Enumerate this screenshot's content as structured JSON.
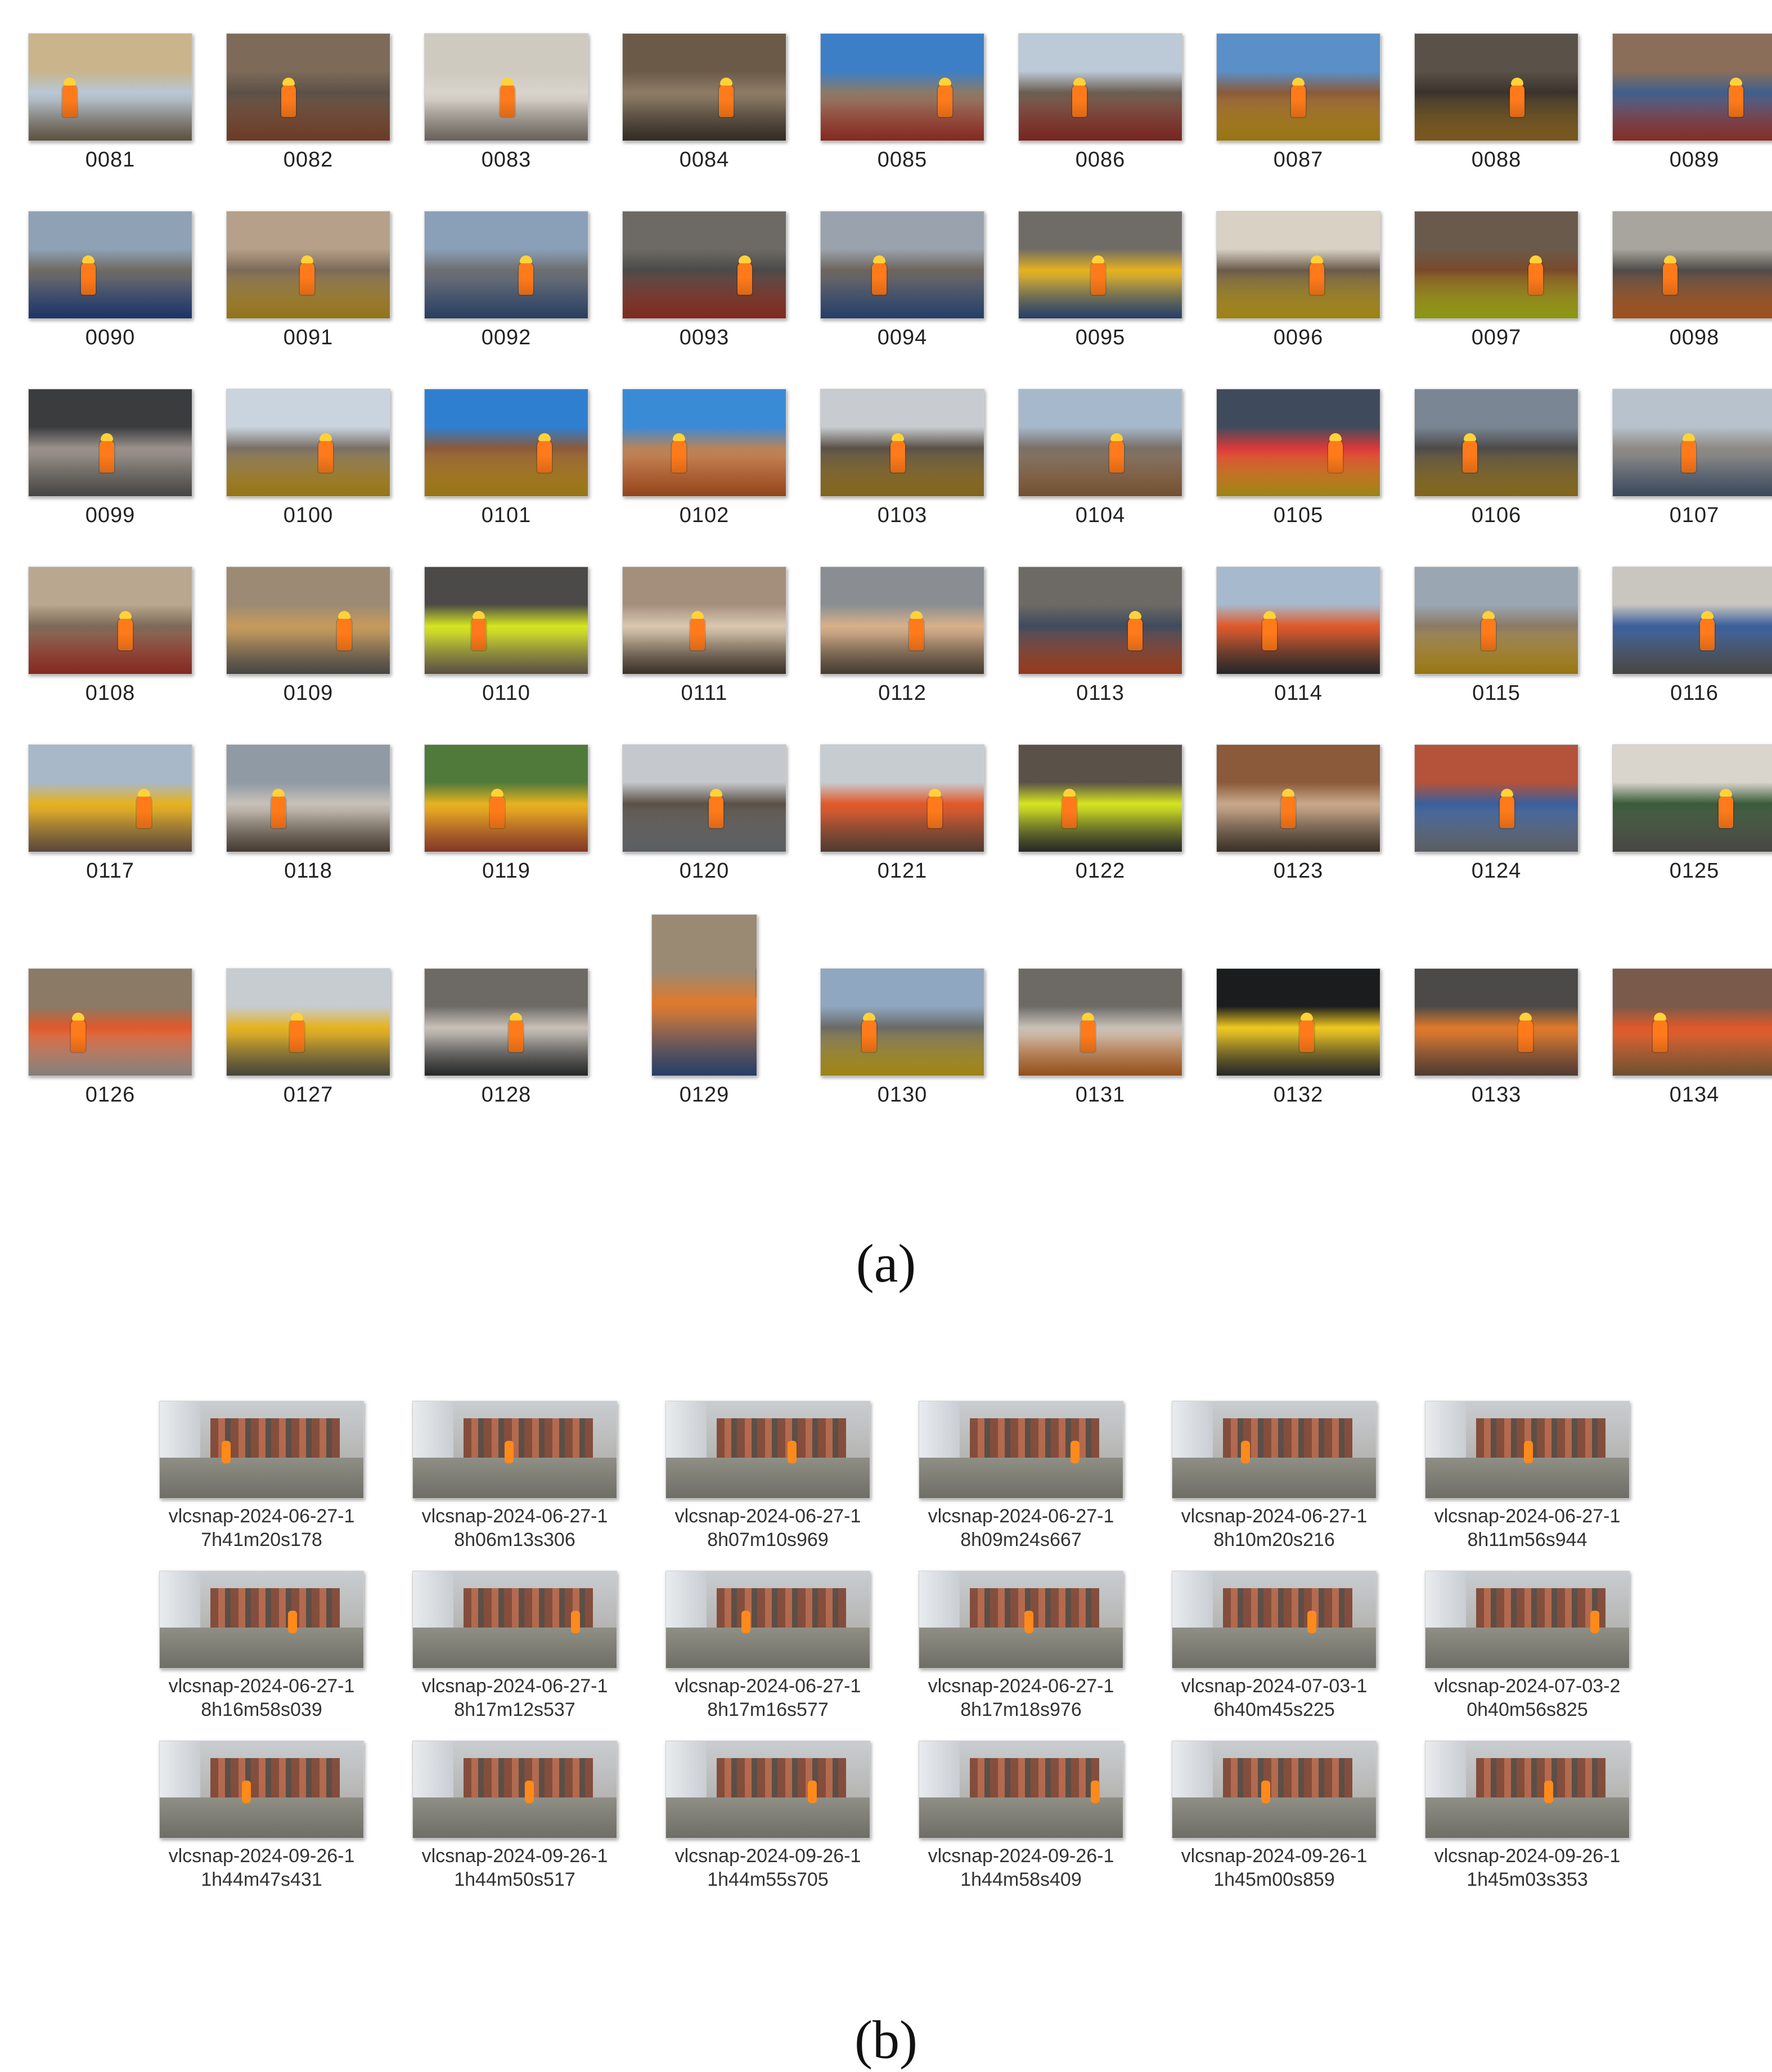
{
  "panel_a": {
    "caption": "(a)",
    "items": [
      {
        "label": "0081",
        "colors": [
          "#c9b48c",
          "#8c7d64",
          "#b8c7d6"
        ]
      },
      {
        "label": "0082",
        "colors": [
          "#7d6a58",
          "#a35a3b",
          "#5b5147"
        ]
      },
      {
        "label": "0083",
        "colors": [
          "#cfcac0",
          "#9d958a",
          "#d9d4cc"
        ]
      },
      {
        "label": "0084",
        "colors": [
          "#6b5a48",
          "#4d4237",
          "#8d7b66"
        ]
      },
      {
        "label": "0085",
        "colors": [
          "#3d7fc7",
          "#c84032",
          "#8a7a66"
        ]
      },
      {
        "label": "0086",
        "colors": [
          "#bcc9d6",
          "#b33a30",
          "#6b5e52"
        ]
      },
      {
        "label": "0087",
        "colors": [
          "#5a8fc8",
          "#e6b21f",
          "#8a5b3a"
        ]
      },
      {
        "label": "0088",
        "colors": [
          "#5a5148",
          "#b8862d",
          "#3a332c"
        ]
      },
      {
        "label": "0089",
        "colors": [
          "#8a6e5a",
          "#c8463a",
          "#3f5f8c"
        ]
      },
      {
        "label": "0090",
        "colors": [
          "#8fa2b5",
          "#2d4f9a",
          "#6f6a62"
        ]
      },
      {
        "label": "0091",
        "colors": [
          "#b6a089",
          "#e0b12a",
          "#7b6a58"
        ]
      },
      {
        "label": "0092",
        "colors": [
          "#8aa0b8",
          "#40608f",
          "#6d6e70"
        ]
      },
      {
        "label": "0093",
        "colors": [
          "#6d6a66",
          "#c1412f",
          "#4b4a48"
        ]
      },
      {
        "label": "0094",
        "colors": [
          "#9aa3ad",
          "#3a5f9c",
          "#6d645c"
        ]
      },
      {
        "label": "0095",
        "colors": [
          "#6f6c68",
          "#3a5f9c",
          "#e6b21f"
        ]
      },
      {
        "label": "0096",
        "colors": [
          "#d9d1c4",
          "#f0c81f",
          "#6a5b4b"
        ]
      },
      {
        "label": "0097",
        "colors": [
          "#6a5a4b",
          "#d5e51f",
          "#7a4a2a"
        ]
      },
      {
        "label": "0098",
        "colors": [
          "#a8a49e",
          "#f0792a",
          "#4f4b48"
        ]
      },
      {
        "label": "0099",
        "colors": [
          "#3a3c3e",
          "#6d6a66",
          "#9a918a"
        ]
      },
      {
        "label": "0100",
        "colors": [
          "#c9d4df",
          "#e6b21f",
          "#7a6f66"
        ]
      },
      {
        "label": "0101",
        "colors": [
          "#2f7fd1",
          "#e6b21f",
          "#8a5a3a"
        ]
      },
      {
        "label": "0102",
        "colors": [
          "#3a8bd6",
          "#e06a2a",
          "#b8835a"
        ]
      },
      {
        "label": "0103",
        "colors": [
          "#c8ccd0",
          "#c79a2a",
          "#5a5148"
        ]
      },
      {
        "label": "0104",
        "colors": [
          "#a6b9cc",
          "#b07a4a",
          "#7a6f66"
        ]
      },
      {
        "label": "0105",
        "colors": [
          "#3f4b5c",
          "#f0c81f",
          "#d93a3a"
        ]
      },
      {
        "label": "0106",
        "colors": [
          "#7a8694",
          "#c79a2a",
          "#4d4b49"
        ]
      },
      {
        "label": "0107",
        "colors": [
          "#b7c2cc",
          "#5a6f8a",
          "#8f8a84"
        ]
      },
      {
        "label": "0108",
        "colors": [
          "#b9a88f",
          "#c84032",
          "#7d6a58"
        ]
      },
      {
        "label": "0109",
        "colors": [
          "#9c8a74",
          "#6d6a66",
          "#c79a5a"
        ]
      },
      {
        "label": "0110",
        "colors": [
          "#4b4a48",
          "#8a7a66",
          "#d5e51f"
        ]
      },
      {
        "label": "0111",
        "colors": [
          "#a48f7c",
          "#5a4b3c",
          "#d9c7b0"
        ]
      },
      {
        "label": "0112",
        "colors": [
          "#8a8e93",
          "#6a5a4b",
          "#d8b08a"
        ]
      },
      {
        "label": "0113",
        "colors": [
          "#6d6a66",
          "#e0592a",
          "#3f4b5c"
        ]
      },
      {
        "label": "0114",
        "colors": [
          "#a7b9cc",
          "#3a3c3e",
          "#e0592a"
        ]
      },
      {
        "label": "0115",
        "colors": [
          "#9aa7b3",
          "#e6b21f",
          "#8a7a66"
        ]
      },
      {
        "label": "0116",
        "colors": [
          "#c9c5bf",
          "#6d6a66",
          "#3a5f9c"
        ]
      },
      {
        "label": "0117",
        "colors": [
          "#a8b8c8",
          "#8a6e5a",
          "#e6b21f"
        ]
      },
      {
        "label": "0118",
        "colors": [
          "#8f9aa5",
          "#6a5a4b",
          "#c8c1b8"
        ]
      },
      {
        "label": "0119",
        "colors": [
          "#4f7a3a",
          "#c8563a",
          "#e6b21f"
        ]
      },
      {
        "label": "0120",
        "colors": [
          "#c5c8cc",
          "#8a8e93",
          "#5a5148"
        ]
      },
      {
        "label": "0121",
        "colors": [
          "#c7ccd1",
          "#7a5a4b",
          "#e0592a"
        ]
      },
      {
        "label": "0122",
        "colors": [
          "#5a5148",
          "#3a3c3e",
          "#d5e51f"
        ]
      },
      {
        "label": "0123",
        "colors": [
          "#8a5a3a",
          "#5a4b3c",
          "#c8a88a"
        ]
      },
      {
        "label": "0124",
        "colors": [
          "#b4523a",
          "#8a8e93",
          "#3a5f9c"
        ]
      },
      {
        "label": "0125",
        "colors": [
          "#d9d4cc",
          "#6d6a66",
          "#3a5a3a"
        ]
      },
      {
        "label": "0126",
        "colors": [
          "#8a7a66",
          "#c8c1b8",
          "#e0592a"
        ]
      },
      {
        "label": "0127",
        "colors": [
          "#c7ccd1",
          "#6a6a58",
          "#e6b21f"
        ]
      },
      {
        "label": "0128",
        "colors": [
          "#6d6a66",
          "#3a3c3e",
          "#c8c1b8"
        ]
      },
      {
        "label": "0129",
        "colors": [
          "#9a8a74",
          "#3a5f9c",
          "#e0792a"
        ]
      },
      {
        "label": "0130",
        "colors": [
          "#8fa7c0",
          "#f0c81f",
          "#6a6a66"
        ]
      },
      {
        "label": "0131",
        "colors": [
          "#6d6a66",
          "#e0792a",
          "#c8c1b8"
        ]
      },
      {
        "label": "0132",
        "colors": [
          "#1b1c1e",
          "#3a3c3e",
          "#f0c81f"
        ]
      },
      {
        "label": "0133",
        "colors": [
          "#4b4a48",
          "#7a5a4b",
          "#e0792a"
        ]
      },
      {
        "label": "0134",
        "colors": [
          "#7a5a4b",
          "#a87a4a",
          "#e0592a"
        ]
      }
    ]
  },
  "panel_b": {
    "caption": "(b)",
    "items": [
      {
        "line1": "vlcsnap-2024-06-27-1",
        "line2": "7h41m20s178"
      },
      {
        "line1": "vlcsnap-2024-06-27-1",
        "line2": "8h06m13s306"
      },
      {
        "line1": "vlcsnap-2024-06-27-1",
        "line2": "8h07m10s969"
      },
      {
        "line1": "vlcsnap-2024-06-27-1",
        "line2": "8h09m24s667"
      },
      {
        "line1": "vlcsnap-2024-06-27-1",
        "line2": "8h10m20s216"
      },
      {
        "line1": "vlcsnap-2024-06-27-1",
        "line2": "8h11m56s944"
      },
      {
        "line1": "vlcsnap-2024-06-27-1",
        "line2": "8h16m58s039"
      },
      {
        "line1": "vlcsnap-2024-06-27-1",
        "line2": "8h17m12s537"
      },
      {
        "line1": "vlcsnap-2024-06-27-1",
        "line2": "8h17m16s577"
      },
      {
        "line1": "vlcsnap-2024-06-27-1",
        "line2": "8h17m18s976"
      },
      {
        "line1": "vlcsnap-2024-07-03-1",
        "line2": "6h40m45s225"
      },
      {
        "line1": "vlcsnap-2024-07-03-2",
        "line2": "0h40m56s825"
      },
      {
        "line1": "vlcsnap-2024-09-26-1",
        "line2": "1h44m47s431"
      },
      {
        "line1": "vlcsnap-2024-09-26-1",
        "line2": "1h44m50s517"
      },
      {
        "line1": "vlcsnap-2024-09-26-1",
        "line2": "1h44m55s705"
      },
      {
        "line1": "vlcsnap-2024-09-26-1",
        "line2": "1h44m58s409"
      },
      {
        "line1": "vlcsnap-2024-09-26-1",
        "line2": "1h45m00s859"
      },
      {
        "line1": "vlcsnap-2024-09-26-1",
        "line2": "1h45m03s353"
      }
    ]
  }
}
